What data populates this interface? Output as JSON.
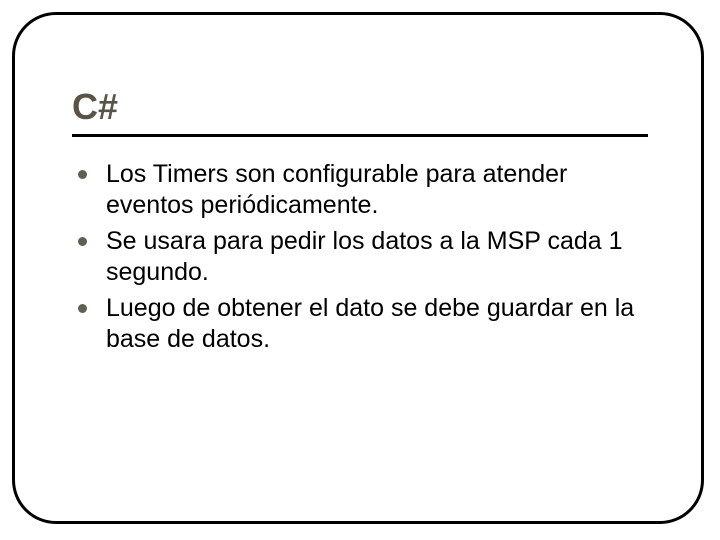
{
  "slide": {
    "title": "C#",
    "bullets": [
      "Los Timers son configurable para atender eventos periódicamente.",
      "Se usara para pedir los datos a la MSP cada 1 segundo.",
      "Luego de obtener el dato se debe guardar en la base de datos."
    ]
  }
}
